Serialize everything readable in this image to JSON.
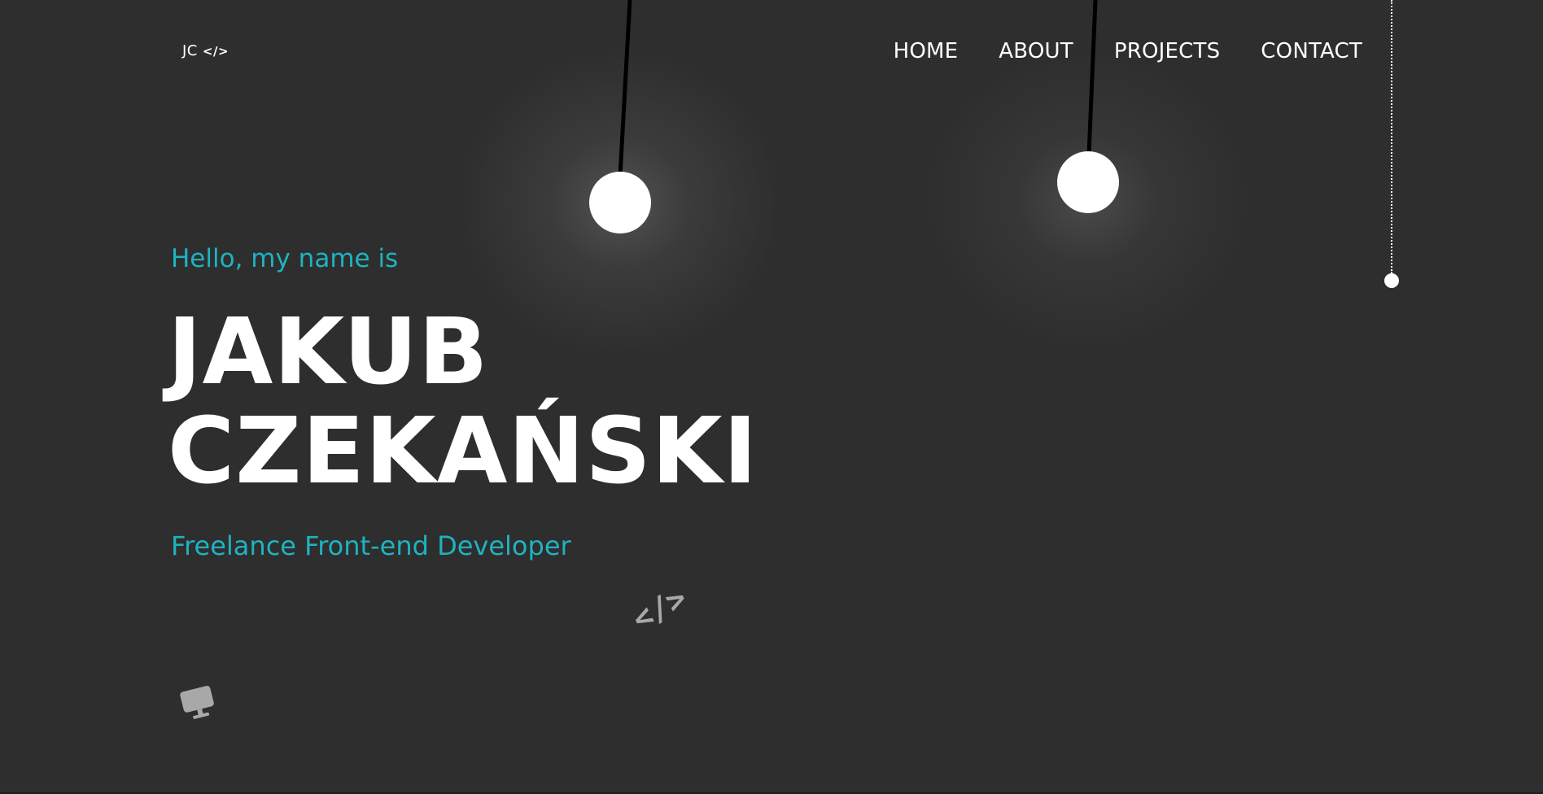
{
  "header": {
    "logo_text": "JC",
    "logo_icon_glyph": "</>",
    "nav": [
      {
        "label": "HOME"
      },
      {
        "label": "ABOUT"
      },
      {
        "label": "PROJECTS"
      },
      {
        "label": "CONTACT"
      }
    ]
  },
  "hero": {
    "greeting": "Hello, my name is",
    "name_line1": "JAKUB",
    "name_line2": "CZEKAŃSKI",
    "role": "Freelance Front-end Developer"
  },
  "decor": {
    "code_glyph": "</>",
    "icons": [
      "code-icon",
      "monitor-icon",
      "lamp-icon"
    ]
  },
  "colors": {
    "background": "#2e2e2e",
    "accent": "#1eb3c0",
    "text": "#ffffff",
    "icon_muted": "#a8a8a8"
  }
}
